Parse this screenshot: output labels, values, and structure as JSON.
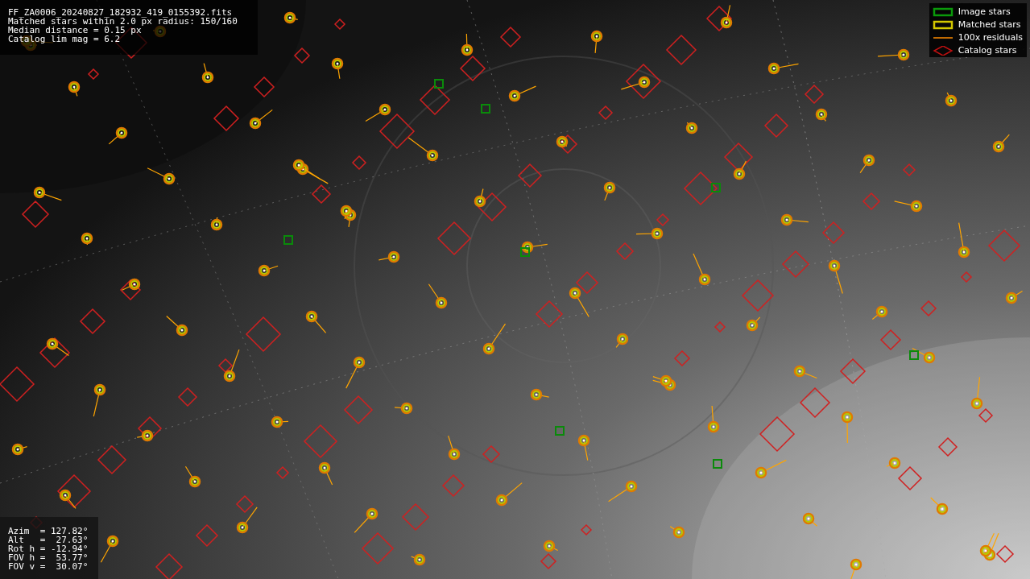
{
  "info_lines": [
    "FF_ZA0006_20240827_182932_419_0155392.fits",
    "Matched stars within 2.0 px radius: 150/160",
    "Median distance = 0.15 px",
    "Catalog lim mag = 6.2"
  ],
  "legend": [
    {
      "label": "Image stars"
    },
    {
      "kind": "matched",
      "label": "Matched stars"
    },
    {
      "kind": "residuals",
      "label": "100x residuals"
    },
    {
      "kind": "catalog",
      "label": "Catalog stars"
    }
  ],
  "pointing_lines": [
    "Azim  = 127.82°",
    "Alt   =  27.63°",
    "Rot h = -12.94°",
    "FOV h =  53.77°",
    "FOV v =  30.07°"
  ]
}
